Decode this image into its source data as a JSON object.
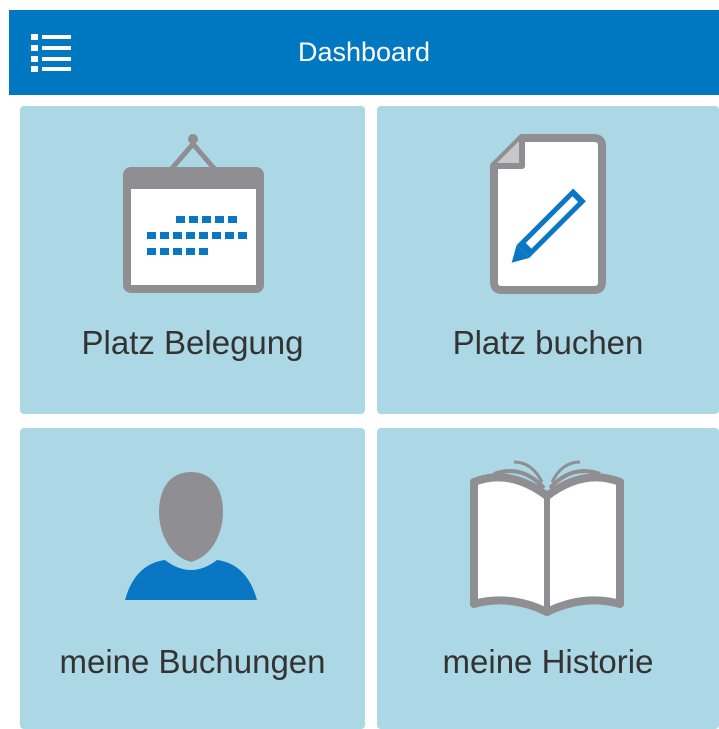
{
  "header": {
    "title": "Dashboard",
    "menu_icon": "list-menu-icon"
  },
  "tiles": [
    {
      "label": "Platz Belegung",
      "icon": "calendar-icon"
    },
    {
      "label": "Platz buchen",
      "icon": "document-pencil-icon"
    },
    {
      "label": "meine Buchungen",
      "icon": "user-icon"
    },
    {
      "label": "meine Historie",
      "icon": "open-book-icon"
    }
  ],
  "colors": {
    "header_bg": "#0078c1",
    "tile_bg": "#acd8e6",
    "icon_gray": "#8e8e93",
    "icon_blue": "#0a77c4",
    "text": "#333333"
  }
}
